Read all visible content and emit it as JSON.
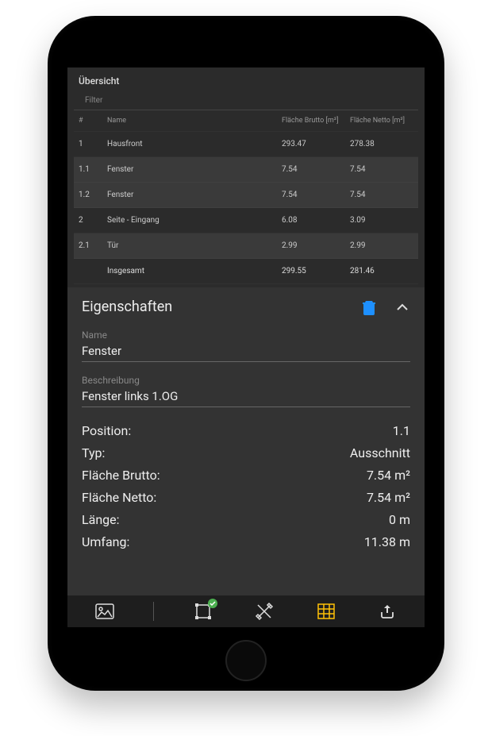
{
  "header": {
    "title": "Übersicht"
  },
  "filter": {
    "label": "Filter"
  },
  "table": {
    "headers": {
      "num": "#",
      "name": "Name",
      "gross": "Fläche Brutto [m²]",
      "net": "Fläche Netto [m²]"
    },
    "rows": [
      {
        "num": "1",
        "name": "Hausfront",
        "gross": "293.47",
        "net": "278.38",
        "sub": false
      },
      {
        "num": "1.1",
        "name": "Fenster",
        "gross": "7.54",
        "net": "7.54",
        "sub": true
      },
      {
        "num": "1.2",
        "name": "Fenster",
        "gross": "7.54",
        "net": "7.54",
        "sub": true
      },
      {
        "num": "2",
        "name": "Seite - Eingang",
        "gross": "6.08",
        "net": "3.09",
        "sub": false
      },
      {
        "num": "2.1",
        "name": "Tür",
        "gross": "2.99",
        "net": "2.99",
        "sub": true
      }
    ],
    "total": {
      "num": "",
      "name": "Insgesamt",
      "gross": "299.55",
      "net": "281.46"
    }
  },
  "panel": {
    "title": "Eigenschaften",
    "fields": {
      "name_label": "Name",
      "name_value": "Fenster",
      "desc_label": "Beschreibung",
      "desc_value": "Fenster links 1.OG"
    },
    "props": [
      {
        "label": "Position:",
        "value": "1.1"
      },
      {
        "label": "Typ:",
        "value": "Ausschnitt"
      },
      {
        "label": "Fläche Brutto:",
        "value": "7.54 m²"
      },
      {
        "label": "Fläche Netto:",
        "value": "7.54 m²"
      },
      {
        "label": "Länge:",
        "value": "0 m"
      },
      {
        "label": "Umfang:",
        "value": "11.38 m"
      }
    ]
  },
  "colors": {
    "accent": "#1E90FF",
    "active": "#FFC107",
    "ok": "#4CAF50"
  }
}
